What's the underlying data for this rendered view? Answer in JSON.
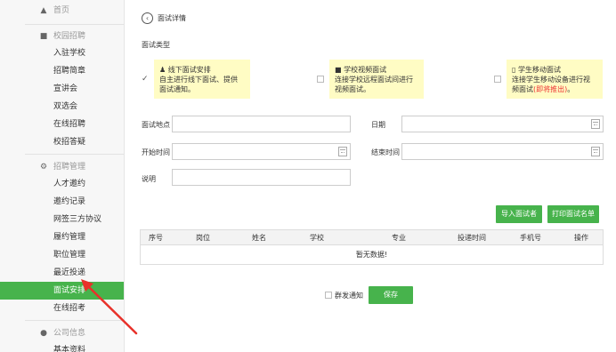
{
  "sidebar": {
    "home": "首页",
    "group_campus": "校园招聘",
    "campus_items": [
      "入驻学校",
      "招聘简章",
      "宣讲会",
      "双选会",
      "在线招聘",
      "校招答疑"
    ],
    "group_manage": "招聘管理",
    "manage_items": [
      "人才邀约",
      "邀约记录",
      "网签三方协议",
      "履约管理",
      "职位管理",
      "最近投递",
      "面试安排",
      "在线招考"
    ],
    "group_company": "公司信息",
    "company_items": [
      "基本资料"
    ],
    "active_item": "面试安排"
  },
  "header": {
    "back_icon": "chevron-left-circle-icon",
    "title": "面试详情"
  },
  "form": {
    "interview_type_label": "面试类型",
    "types": [
      {
        "title": "线下面试安排",
        "desc1": "自主进行线下面试、提供",
        "desc2": "面试通知。",
        "icon": "person-icon",
        "checked": true
      },
      {
        "title": "学校视频面试",
        "desc1": "连接学校远程面试间进行",
        "desc2": "视频面试。",
        "icon": "video-camera-icon",
        "checked": false
      },
      {
        "title": "学生移动面试",
        "desc1": "连接学生移动设备进行视",
        "desc2": "频面试",
        "note": "(即将推出)",
        "suffix": "。",
        "icon": "mobile-phone-icon",
        "checked": false
      }
    ],
    "location_label": "面试地点",
    "date_label": "日期",
    "start_label": "开始时间",
    "end_label": "结束时间",
    "remark_label": "说明"
  },
  "actions": {
    "import_label": "导入面试者",
    "print_label": "打印面试名单",
    "notify_label": "群发通知",
    "save_label": "保存"
  },
  "table": {
    "columns": [
      "序号",
      "岗位",
      "姓名",
      "学校",
      "专业",
      "投递时间",
      "手机号",
      "操作"
    ],
    "empty_text": "暂无数据!"
  },
  "colors": {
    "accent": "#47b34c",
    "highlight_bg": "#fffcc4",
    "annotation": "#e8312a"
  }
}
